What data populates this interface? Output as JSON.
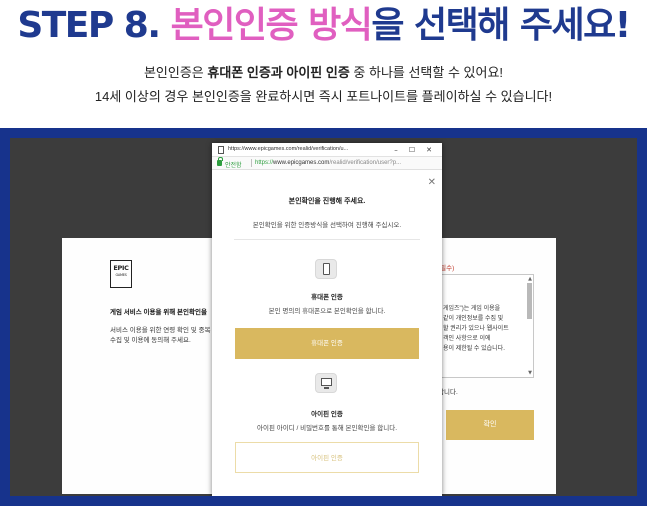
{
  "header": {
    "step": "STEP 8.",
    "highlight": "본인인증 방식",
    "tail": "을 선택해 주세요!",
    "line1_pre": "본인인증은 ",
    "line1_bold": "휴대폰 인증과 아이핀 인증",
    "line1_post": " 중 하나를 선택할 수 있어요!",
    "line2": "14세 이상의 경우 본인인증을 완료하시면 즉시 포트나이트를 플레이하실 수 있습니다!"
  },
  "colors": {
    "navy": "#1f3a8f",
    "pink": "#e05fc0",
    "gold": "#d9b85f",
    "frame": "#17338c",
    "stage": "#3c3c3c"
  },
  "background_page": {
    "logo_text": "EPIC",
    "logo_sub": "GAMES",
    "heading": "게임 서비스 이용을 위해 본인확인을",
    "body_line1": "서비스 이용을 위한 연령 확인 및 중복",
    "body_line2": "수집 및 이용에 동의해 주세요.",
    "required": "(필수)",
    "terms_lines": [
      "게임즈\")는 게임 이용을",
      "같이 개인정보를 수집 및",
      "할 권리가 있으나 웹사이트",
      "객인 사항으로 이에",
      "용이 제한될 수 있습니다."
    ],
    "terms_tail": "합니다.",
    "confirm": "확인"
  },
  "popup": {
    "titlebar_url": "https://www.epicgames.com/realid/verification/u...",
    "secure_label": "안전함",
    "addr_scheme": "https://",
    "addr_domain": "www.epicgames.com",
    "addr_path": "/realid/verification/user?p...",
    "title": "본인확인을 진행해 주세요.",
    "subtitle": "본인확인을 위한 인증방식을 선택하여 진행해 주십시오.",
    "methods": [
      {
        "icon": "mobile-phone-icon",
        "label": "휴대폰 인증",
        "desc": "본인 명의의 휴대폰으로 본인확인을 합니다.",
        "button": "휴대폰 인증"
      },
      {
        "icon": "ipin-monitor-icon",
        "label": "아이핀 인증",
        "desc": "아이핀 아이디 / 비밀번호를 통해 본인확인을 합니다.",
        "button": "아이핀 인증"
      }
    ]
  }
}
